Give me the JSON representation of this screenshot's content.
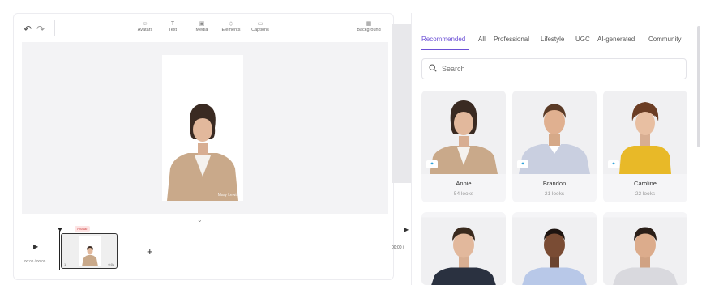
{
  "toolbar": {
    "undo_icon": "undo-icon",
    "redo_icon": "redo-icon",
    "tools": [
      {
        "label": "Avatars",
        "icon": "avatar-icon"
      },
      {
        "label": "Text",
        "icon": "text-icon"
      },
      {
        "label": "Media",
        "icon": "media-icon"
      },
      {
        "label": "Elements",
        "icon": "elements-icon"
      },
      {
        "label": "Captions",
        "icon": "captions-icon"
      }
    ],
    "background": {
      "label": "Background",
      "icon": "background-icon"
    }
  },
  "canvas": {
    "watermark": "Mary Lewis"
  },
  "timeline": {
    "badge": "Avatar",
    "time": "00:00 / 00:00",
    "clip_number": "1",
    "clip_duration": "0:0s"
  },
  "preview": {
    "time": "00:00 /"
  },
  "panel": {
    "tabs": [
      "Recommended",
      "All",
      "Professional",
      "Lifestyle",
      "UGC",
      "AI-generated",
      "Community"
    ],
    "active_tab": "Recommended",
    "search": {
      "placeholder": "Search"
    },
    "avatars": [
      {
        "name": "Annie",
        "looks": "54 looks"
      },
      {
        "name": "Brandon",
        "looks": "21 looks"
      },
      {
        "name": "Caroline",
        "looks": "22 looks"
      }
    ]
  },
  "colors": {
    "accent": "#6b4fd6",
    "badge_text": "#d04848",
    "ai_badge": "#1f9ad6"
  }
}
